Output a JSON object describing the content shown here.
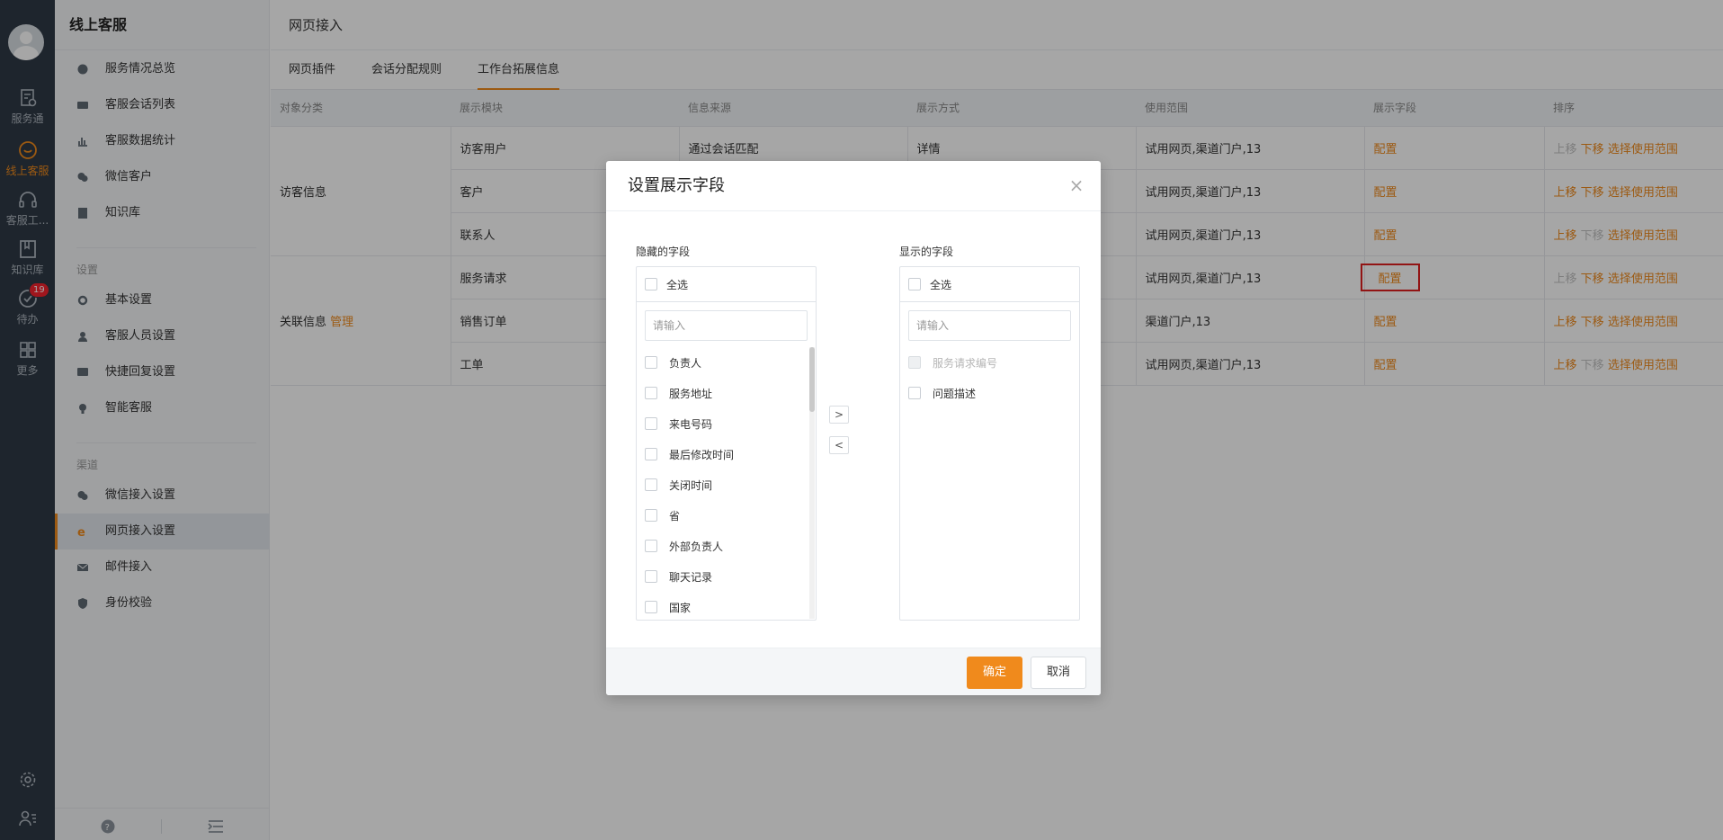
{
  "rail": {
    "items": [
      {
        "label": "服务通",
        "icon": "service-icon"
      },
      {
        "label": "线上客服",
        "icon": "chat-bubble-icon"
      },
      {
        "label": "客服工...",
        "icon": "headset-icon"
      },
      {
        "label": "知识库",
        "icon": "book-icon"
      },
      {
        "label": "待办",
        "icon": "check-circle-icon",
        "badge": "19"
      },
      {
        "label": "更多",
        "icon": "grid-icon"
      }
    ]
  },
  "sidebar": {
    "title": "线上客服",
    "items": [
      "服务情况总览",
      "客服会话列表",
      "客服数据统计",
      "微信客户",
      "知识库"
    ],
    "settings_label": "设置",
    "settings_items": [
      "基本设置",
      "客服人员设置",
      "快捷回复设置",
      "智能客服"
    ],
    "channels_label": "渠道",
    "channel_items": [
      "微信接入设置",
      "网页接入设置",
      "邮件接入",
      "身份校验"
    ]
  },
  "main": {
    "breadcrumb": "网页接入",
    "tabs": [
      "网页插件",
      "会话分配规则",
      "工作台拓展信息"
    ],
    "table": {
      "headers": [
        "对象分类",
        "展示模块",
        "信息来源",
        "展示方式",
        "使用范围",
        "展示字段",
        "排序"
      ],
      "group1": "访客信息",
      "group2": "关联信息",
      "group2_link": "管理",
      "rows": [
        {
          "module": "访客用户",
          "source": "通过会话匹配",
          "mode": "详情",
          "scope": "试用网页,渠道门户,13",
          "field": "配置"
        },
        {
          "module": "客户",
          "source": "",
          "mode": "",
          "scope": "试用网页,渠道门户,13",
          "field": "配置"
        },
        {
          "module": "联系人",
          "source": "",
          "mode": "",
          "scope": "试用网页,渠道门户,13",
          "field": "配置"
        },
        {
          "module": "服务请求",
          "source": "",
          "mode": "",
          "scope": "试用网页,渠道门户,13",
          "field": "配置"
        },
        {
          "module": "销售订单",
          "source": "",
          "mode": "",
          "scope": "渠道门户,13",
          "field": "配置"
        },
        {
          "module": "工单",
          "source": "",
          "mode": "",
          "scope": "试用网页,渠道门户,13",
          "field": "配置"
        }
      ],
      "sort": {
        "up": "上移",
        "down": "下移",
        "scope": "选择使用范围"
      }
    }
  },
  "modal": {
    "title": "设置展示字段",
    "hidden_label": "隐藏的字段",
    "shown_label": "显示的字段",
    "select_all": "全选",
    "search_placeholder": "请输入",
    "hidden_fields": [
      "负责人",
      "服务地址",
      "来电号码",
      "最后修改时间",
      "关闭时间",
      "省",
      "外部负责人",
      "聊天记录",
      "国家"
    ],
    "shown_fields": [
      "服务请求编号",
      "问题描述"
    ],
    "move_right": ">",
    "move_left": "<",
    "ok": "确定",
    "cancel": "取消",
    "close": "×"
  },
  "colors": {
    "accent": "#f08a1c",
    "rail_bg": "#2f3a45",
    "highlight": "#e02020"
  }
}
